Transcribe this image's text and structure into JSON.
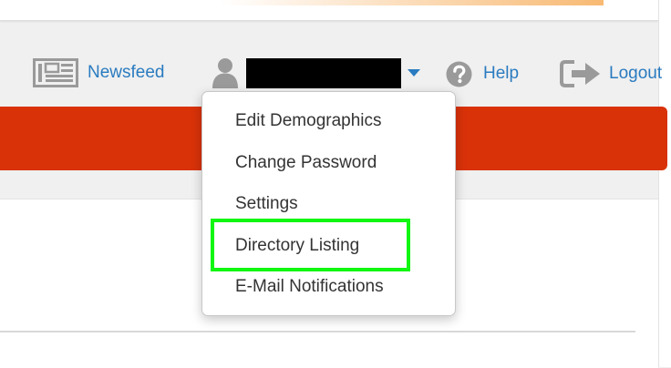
{
  "nav": {
    "newsfeed_label": "Newsfeed",
    "help_label": "Help",
    "logout_label": "Logout",
    "user_name_redacted": true,
    "newsfeed_icon": "newspaper-icon",
    "user_icon": "user-icon",
    "help_icon": "question-circle-icon",
    "logout_icon": "sign-out-icon",
    "caret_icon": "caret-down-icon"
  },
  "user_menu": {
    "items": [
      {
        "label": "Edit Demographics"
      },
      {
        "label": "Change Password"
      },
      {
        "label": "Settings"
      },
      {
        "label": "Directory Listing",
        "highlighted": true
      },
      {
        "label": "E-Mail Notifications"
      }
    ]
  },
  "colors": {
    "link_blue": "#2a7bc0",
    "banner_red": "#d93209",
    "icon_gray": "#9a9a9a",
    "highlight_green": "#11f711",
    "menu_text": "#333333"
  }
}
